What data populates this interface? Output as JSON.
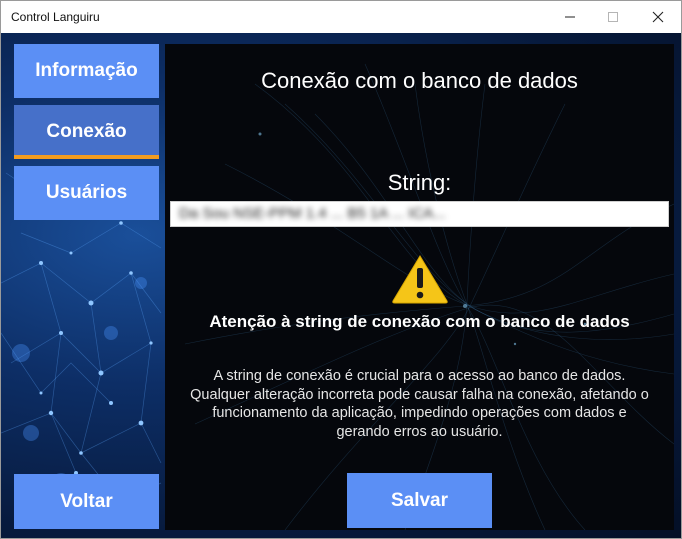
{
  "window": {
    "title": "Control Languiru"
  },
  "sidebar": {
    "items": [
      {
        "label": "Informação",
        "selected": false
      },
      {
        "label": "Conexão",
        "selected": true
      },
      {
        "label": "Usuários",
        "selected": false
      }
    ],
    "back_label": "Voltar"
  },
  "main": {
    "title": "Conexão com o banco de dados",
    "string_label": "String:",
    "string_value": "Da      Sou      NSE-PPM 1.4 ... B5 1A ... ICA...",
    "warning": {
      "icon": "warning-icon",
      "heading": "Atenção à string de conexão com o banco de dados",
      "body_lines": [
        "A string de conexão é crucial para o acesso ao banco de dados.",
        "Qualquer alteração incorreta pode causar falha na conexão, afetando o",
        "funcionamento da aplicação, impedindo operações com dados e",
        "gerando erros ao usuário."
      ]
    },
    "save_label": "Salvar"
  },
  "colors": {
    "nav_button": "#5b8ff5",
    "nav_selected": "#4670c9",
    "selected_underline": "#f39c1f",
    "panel_background": "#05070c",
    "warning_yellow": "#f5c518"
  }
}
